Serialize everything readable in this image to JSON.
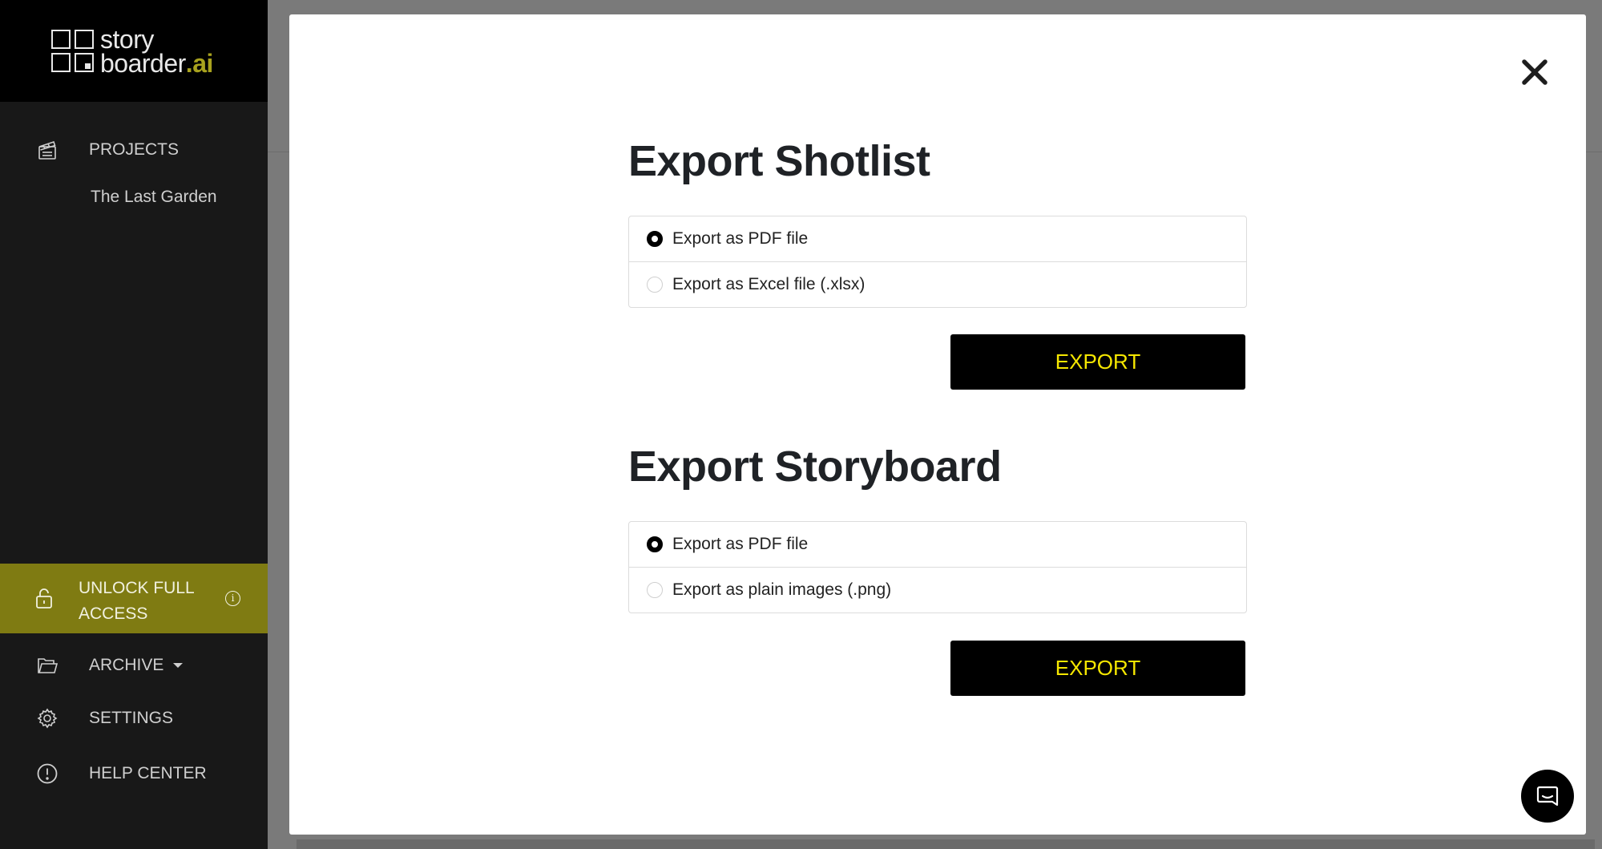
{
  "sidebar": {
    "logo": {
      "line1": "story",
      "line2": "boarder",
      "suffix": ".ai"
    },
    "projects_label": "PROJECTS",
    "project_name": "The Last Garden",
    "unlock_line1": "UNLOCK FULL",
    "unlock_line2": "ACCESS",
    "archive_label": "ARCHIVE",
    "settings_label": "SETTINGS",
    "help_label": "HELP CENTER"
  },
  "modal": {
    "shotlist": {
      "title": "Export Shotlist",
      "options": [
        {
          "label": "Export as PDF file",
          "checked": true
        },
        {
          "label": "Export as Excel file (.xlsx)",
          "checked": false
        }
      ],
      "button": "EXPORT"
    },
    "storyboard": {
      "title": "Export Storyboard",
      "options": [
        {
          "label": "Export as PDF file",
          "checked": true
        },
        {
          "label": "Export as plain images (.png)",
          "checked": false
        }
      ],
      "button": "EXPORT"
    }
  },
  "colors": {
    "accent_yellow": "#f5e700",
    "unlock_bg": "#7f7b12",
    "sidebar_bg": "#181818",
    "overlay": "#7a7a7a"
  }
}
